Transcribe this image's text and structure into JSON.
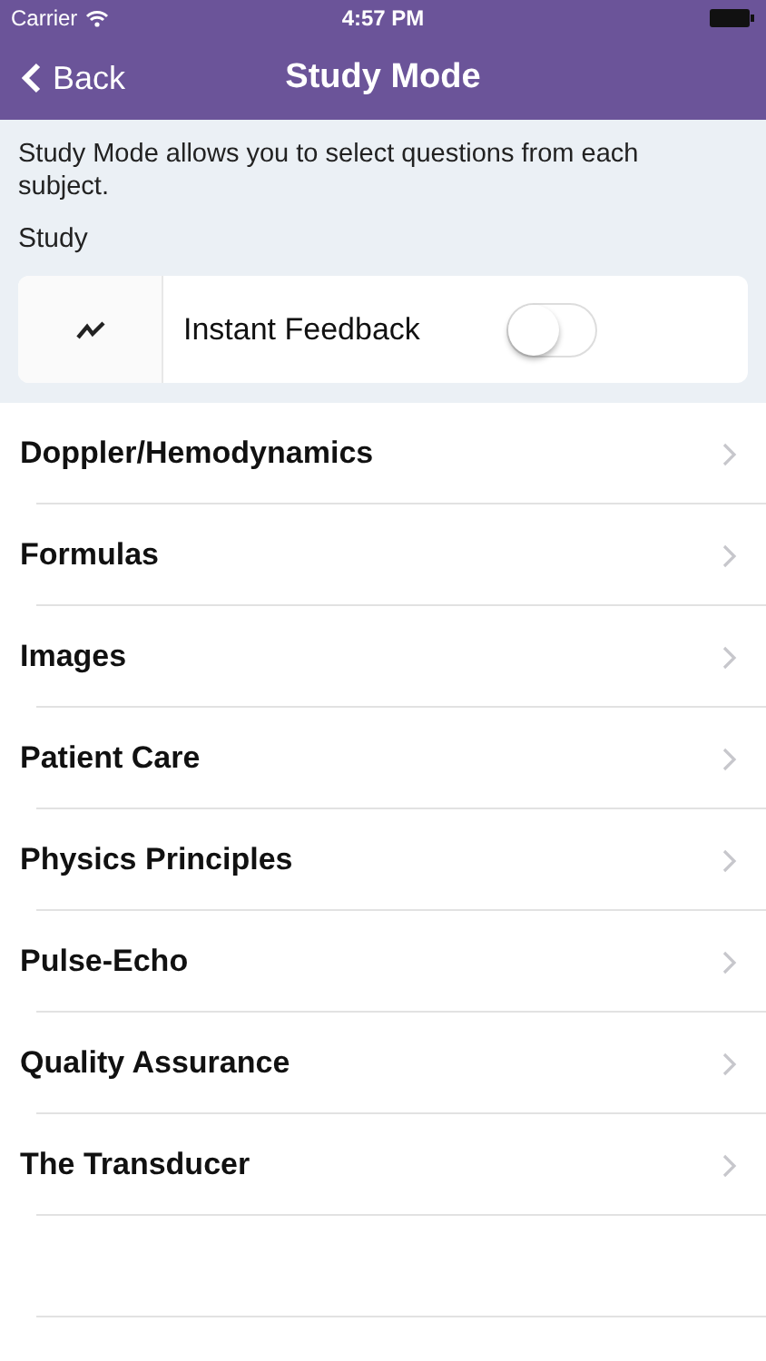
{
  "status_bar": {
    "carrier": "Carrier",
    "time": "4:57 PM"
  },
  "nav": {
    "back": "Back",
    "title": "Study Mode"
  },
  "description": "Study Mode allows you to select questions from each subject.",
  "section_label": "Study",
  "setting": {
    "label": "Instant Feedback",
    "on": false
  },
  "subjects": [
    {
      "label": "Doppler/Hemodynamics"
    },
    {
      "label": "Formulas"
    },
    {
      "label": "Images"
    },
    {
      "label": "Patient Care"
    },
    {
      "label": "Physics Principles"
    },
    {
      "label": "Pulse-Echo"
    },
    {
      "label": "Quality Assurance"
    },
    {
      "label": "The Transducer"
    }
  ]
}
